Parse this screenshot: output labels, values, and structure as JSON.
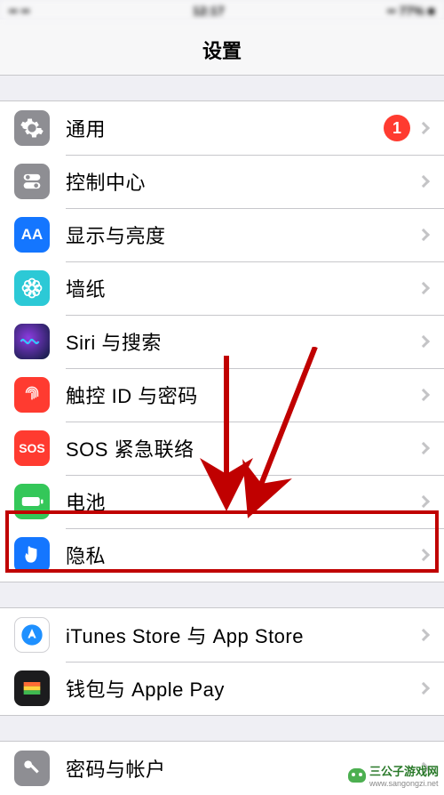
{
  "statusbar": {
    "time": "12:17",
    "carrier": "•• ••",
    "right": "•• 77% ■"
  },
  "header": {
    "title": "设置"
  },
  "group1": [
    {
      "label": "通用",
      "badge": "1",
      "icon": "general"
    },
    {
      "label": "控制中心",
      "icon": "control"
    },
    {
      "label": "显示与亮度",
      "icon": "display"
    },
    {
      "label": "墙纸",
      "icon": "wallpaper"
    },
    {
      "label": "Siri 与搜索",
      "icon": "siri"
    },
    {
      "label": "触控 ID 与密码",
      "icon": "touchid"
    },
    {
      "label": "SOS 紧急联络",
      "icon": "sos"
    },
    {
      "label": "电池",
      "icon": "battery"
    },
    {
      "label": "隐私",
      "icon": "privacy",
      "highlighted": true
    }
  ],
  "group2": [
    {
      "label": "iTunes Store 与 App Store",
      "icon": "itunes"
    },
    {
      "label": "钱包与 Apple Pay",
      "icon": "wallet"
    }
  ],
  "group3": [
    {
      "label": "密码与帐户",
      "icon": "accounts"
    }
  ],
  "watermark": "三公子游戏网",
  "watermark_url": "www.sangongzi.net"
}
